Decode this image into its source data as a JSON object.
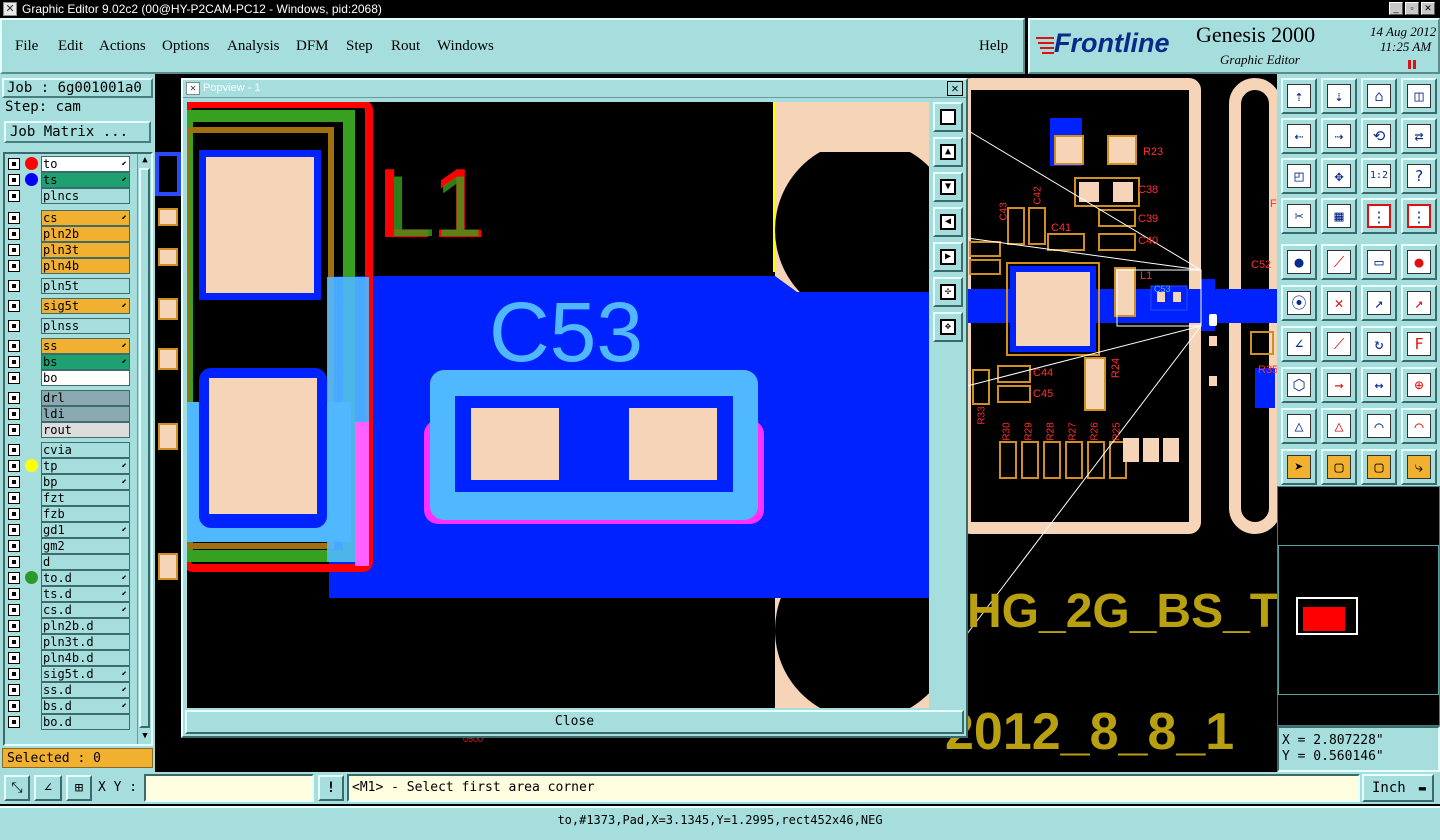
{
  "window": {
    "title": "Graphic Editor 9.02c2 (00@HY-P2CAM-PC12 - Windows, pid:2068)"
  },
  "menu": [
    "File",
    "Edit",
    "Actions",
    "Options",
    "Analysis",
    "DFM",
    "Step",
    "Rout",
    "Windows"
  ],
  "help_label": "Help",
  "brand": {
    "logo": "Frontline",
    "product": "Genesis 2000",
    "subtitle": "Graphic Editor",
    "date": "14 Aug 2012",
    "time": "11:25 AM"
  },
  "job": {
    "job_label": "Job : 6g001001a0",
    "step_label": "Step: cam",
    "matrix_button": "Job Matrix ..."
  },
  "layers": [
    {
      "name": "to",
      "color": "#ffffff",
      "dot": "#ff0000",
      "active": true
    },
    {
      "name": "ts",
      "color": "#1fa070",
      "dot": "#0000ff",
      "active": true
    },
    {
      "name": "plncs",
      "color": "#a6dede",
      "dot": null,
      "active": false
    },
    {
      "name": "cs",
      "color": "#f2b030",
      "dot": null,
      "active": true
    },
    {
      "name": "pln2b",
      "color": "#f2b030",
      "dot": null,
      "active": false
    },
    {
      "name": "pln3t",
      "color": "#f2b030",
      "dot": null,
      "active": false
    },
    {
      "name": "pln4b",
      "color": "#f2b030",
      "dot": null,
      "active": false
    },
    {
      "name": "pln5t",
      "color": "#a6dede",
      "dot": null,
      "active": false
    },
    {
      "name": "sig5t",
      "color": "#f2b030",
      "dot": null,
      "active": true
    },
    {
      "name": "plnss",
      "color": "#a6dede",
      "dot": null,
      "active": false
    },
    {
      "name": "ss",
      "color": "#f2b030",
      "dot": null,
      "active": true
    },
    {
      "name": "bs",
      "color": "#1fa070",
      "dot": null,
      "active": true
    },
    {
      "name": "bo",
      "color": "#ffffff",
      "dot": null,
      "active": false
    },
    {
      "name": "drl",
      "color": "#8aa8b0",
      "dot": null,
      "active": false
    },
    {
      "name": "ldi",
      "color": "#8aa8b0",
      "dot": null,
      "active": false
    },
    {
      "name": "rout",
      "color": "#dcdcdc",
      "dot": null,
      "active": false
    },
    {
      "name": "cvia",
      "color": "#a6dede",
      "dot": null,
      "active": false
    },
    {
      "name": "tp",
      "color": "#a6dede",
      "dot": "#ffff00",
      "active": true
    },
    {
      "name": "bp",
      "color": "#a6dede",
      "dot": null,
      "active": true
    },
    {
      "name": "fzt",
      "color": "#a6dede",
      "dot": null,
      "active": false
    },
    {
      "name": "fzb",
      "color": "#a6dede",
      "dot": null,
      "active": false
    },
    {
      "name": "gd1",
      "color": "#a6dede",
      "dot": null,
      "active": true
    },
    {
      "name": "gm2",
      "color": "#a6dede",
      "dot": null,
      "active": false
    },
    {
      "name": "d",
      "color": "#a6dede",
      "dot": null,
      "active": false
    },
    {
      "name": "to.d",
      "color": "#a6dede",
      "dot": "#2a9a2a",
      "active": true
    },
    {
      "name": "ts.d",
      "color": "#a6dede",
      "dot": null,
      "active": true
    },
    {
      "name": "cs.d",
      "color": "#a6dede",
      "dot": null,
      "active": true
    },
    {
      "name": "pln2b.d",
      "color": "#a6dede",
      "dot": null,
      "active": false
    },
    {
      "name": "pln3t.d",
      "color": "#a6dede",
      "dot": null,
      "active": false
    },
    {
      "name": "pln4b.d",
      "color": "#a6dede",
      "dot": null,
      "active": false
    },
    {
      "name": "sig5t.d",
      "color": "#a6dede",
      "dot": null,
      "active": true
    },
    {
      "name": "ss.d",
      "color": "#a6dede",
      "dot": null,
      "active": true
    },
    {
      "name": "bs.d",
      "color": "#a6dede",
      "dot": null,
      "active": true
    },
    {
      "name": "bo.d",
      "color": "#a6dede",
      "dot": null,
      "active": false
    }
  ],
  "selected": "Selected : 0",
  "popview": {
    "title": "Popview - 1",
    "close_label": "Close",
    "labels": {
      "ref1": "L1",
      "ref2": "C53"
    }
  },
  "board_labels": [
    "R23",
    "C38",
    "C39",
    "C40",
    "C41",
    "C42",
    "C43",
    "L1",
    "C53",
    "C52",
    "R24",
    "C44",
    "C45",
    "R33",
    "R30",
    "R29",
    "R28",
    "R27",
    "R26",
    "R25",
    "R35",
    "F"
  ],
  "board_text": {
    "line1": "HG_2G_BS_T",
    "line2": "2012_8_8_1",
    "small": "0500"
  },
  "coords": {
    "x": "X = 2.807228\"",
    "y": "Y = 0.560146\""
  },
  "xy_label": "X Y :",
  "xy_value": "",
  "prompt": "<M1> - Select first area corner",
  "units": "Inch",
  "status": "to,#1373,Pad,X=3.1345,Y=1.2995,rect452x46,NEG",
  "icon_names": [
    "move-up-icon",
    "move-down-icon",
    "home-icon",
    "split-view-icon",
    "move-left-icon",
    "move-right-icon",
    "rotate-icon",
    "swap-icon",
    "zoom-fit-icon",
    "zoom-center-icon",
    "scale-1-2-icon",
    "help-icon",
    "tool-set-icon",
    "grid-icon",
    "layer-snap-icon",
    "layer-snap-alt-icon",
    "pad-select-icon",
    "line-select-icon",
    "measure-icon",
    "circle-pad-icon",
    "net-icon",
    "cross-icon",
    "point-arrow-icon",
    "point-arrow-alt-icon",
    "angle-icon",
    "line-draw-icon",
    "arc-icon",
    "text-f-icon",
    "node-icon",
    "arrow-line-icon",
    "dimension-icon",
    "route-icon",
    "triangle-icon",
    "triangle-blue-icon",
    "arch-icon",
    "arch-cross-icon",
    "pointer-icon",
    "select-box-icon",
    "select-box-alt-icon",
    "net-trace-icon"
  ]
}
